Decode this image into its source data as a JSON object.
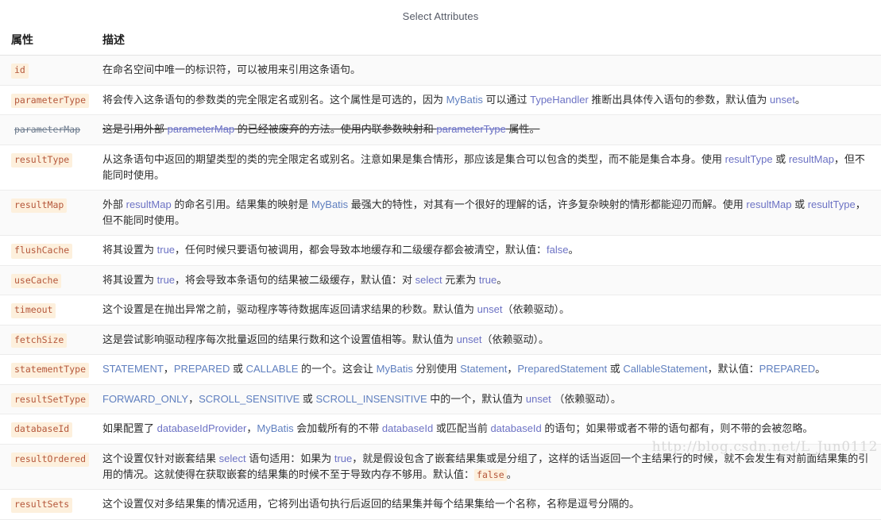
{
  "caption": "Select Attributes",
  "watermark": "http://blog.csdn.net/L_Jun0112",
  "colors": {
    "chip_bg": "#fdf0dd",
    "chip_text": "#b5573b",
    "keyword": "#6c72c4",
    "keyword_blue": "#5f7fbf",
    "row_alt_bg": "#fafafa",
    "row_border": "#ececec",
    "watermark": "#d9d9d9"
  },
  "table": {
    "headers": {
      "attribute": "属性",
      "description": "描述"
    },
    "rows": [
      {
        "attribute": "id",
        "deprecated": false,
        "description": "在命名空间中唯一的标识符，可以被用来引用这条语句。"
      },
      {
        "attribute": "parameterType",
        "deprecated": false,
        "description": "将会传入这条语句的参数类的完全限定名或别名。这个属性是可选的，因为 MyBatis 可以通过 TypeHandler 推断出具体传入语句的参数，默认值为 unset。"
      },
      {
        "attribute": "parameterMap",
        "deprecated": true,
        "description": "这是引用外部 parameterMap 的已经被废弃的方法。使用内联参数映射和 parameterType 属性。"
      },
      {
        "attribute": "resultType",
        "deprecated": false,
        "description": "从这条语句中返回的期望类型的类的完全限定名或别名。注意如果是集合情形，那应该是集合可以包含的类型，而不能是集合本身。使用 resultType 或 resultMap，但不能同时使用。"
      },
      {
        "attribute": "resultMap",
        "deprecated": false,
        "description": "外部 resultMap 的命名引用。结果集的映射是 MyBatis 最强大的特性，对其有一个很好的理解的话，许多复杂映射的情形都能迎刃而解。使用 resultMap 或 resultType，但不能同时使用。"
      },
      {
        "attribute": "flushCache",
        "deprecated": false,
        "description": "将其设置为 true，任何时候只要语句被调用，都会导致本地缓存和二级缓存都会被清空，默认值：false。"
      },
      {
        "attribute": "useCache",
        "deprecated": false,
        "description": "将其设置为 true，将会导致本条语句的结果被二级缓存，默认值：对 select 元素为 true。"
      },
      {
        "attribute": "timeout",
        "deprecated": false,
        "description": "这个设置是在抛出异常之前，驱动程序等待数据库返回请求结果的秒数。默认值为 unset（依赖驱动）。"
      },
      {
        "attribute": "fetchSize",
        "deprecated": false,
        "description": "这是尝试影响驱动程序每次批量返回的结果行数和这个设置值相等。默认值为 unset（依赖驱动）。"
      },
      {
        "attribute": "statementType",
        "deprecated": false,
        "description": "STATEMENT，PREPARED 或 CALLABLE 的一个。这会让 MyBatis 分别使用 Statement，PreparedStatement 或 CallableStatement，默认值：PREPARED。"
      },
      {
        "attribute": "resultSetType",
        "deprecated": false,
        "description": "FORWARD_ONLY，SCROLL_SENSITIVE 或 SCROLL_INSENSITIVE 中的一个，默认值为 unset （依赖驱动）。"
      },
      {
        "attribute": "databaseId",
        "deprecated": false,
        "description": "如果配置了 databaseIdProvider，MyBatis 会加载所有的不带 databaseId 或匹配当前 databaseId 的语句；如果带或者不带的语句都有，则不带的会被忽略。"
      },
      {
        "attribute": "resultOrdered",
        "deprecated": false,
        "description": "这个设置仅针对嵌套结果 select 语句适用：如果为 true，就是假设包含了嵌套结果集或是分组了，这样的话当返回一个主结果行的时候，就不会发生有对前面结果集的引用的情况。这就使得在获取嵌套的结果集的时候不至于导致内存不够用。默认值：false。"
      },
      {
        "attribute": "resultSets",
        "deprecated": false,
        "description": "这个设置仅对多结果集的情况适用，它将列出语句执行后返回的结果集并每个结果集给一个名称，名称是逗号分隔的。"
      }
    ]
  }
}
